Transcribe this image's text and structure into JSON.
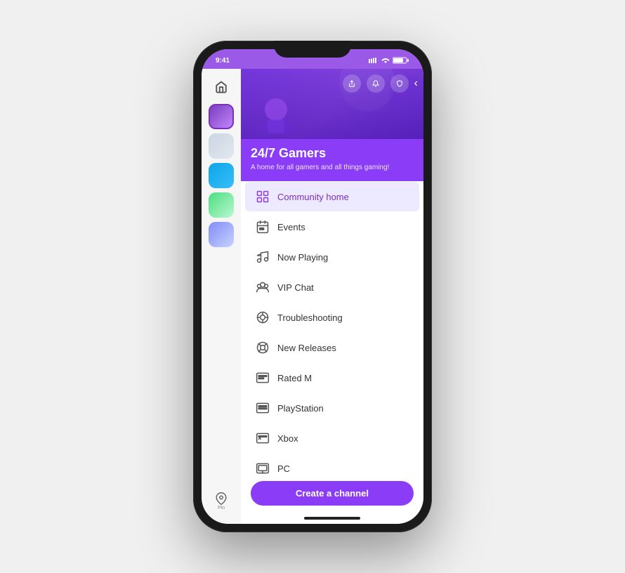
{
  "community": {
    "name": "24/7 Gamers",
    "description": "A home for all gamers and all things gaming!",
    "accent_color": "#8b3cf7"
  },
  "channels": [
    {
      "id": "community-home",
      "label": "Community home",
      "active": true,
      "icon": "home"
    },
    {
      "id": "events",
      "label": "Events",
      "active": false,
      "icon": "calendar"
    },
    {
      "id": "now-playing",
      "label": "Now Playing",
      "active": false,
      "icon": "music"
    },
    {
      "id": "vip-chat",
      "label": "VIP Chat",
      "active": false,
      "icon": "vip"
    },
    {
      "id": "troubleshooting",
      "label": "Troubleshooting",
      "active": false,
      "icon": "wrench"
    },
    {
      "id": "new-releases",
      "label": "New Releases",
      "active": false,
      "icon": "new"
    },
    {
      "id": "rated-m",
      "label": "Rated M",
      "active": false,
      "icon": "rated"
    },
    {
      "id": "playstation",
      "label": "PlayStation",
      "active": false,
      "icon": "playstation"
    },
    {
      "id": "xbox",
      "label": "Xbox",
      "active": false,
      "icon": "xbox"
    },
    {
      "id": "pc",
      "label": "PC",
      "active": false,
      "icon": "pc"
    }
  ],
  "create_channel_label": "Create a channel",
  "pin_label": "Pin",
  "header_icons": [
    "share",
    "bell",
    "shield"
  ],
  "status_bar": {
    "time": "9:41",
    "icons": "▐▐▐ ◆ ▮▮▮"
  }
}
